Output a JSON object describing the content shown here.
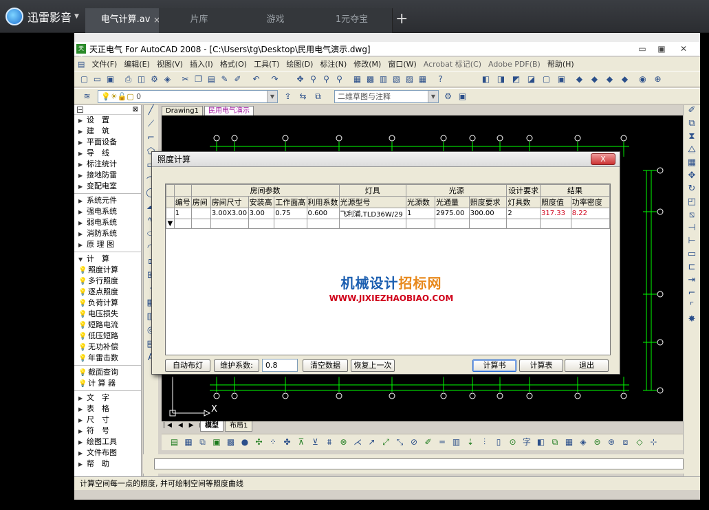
{
  "player": {
    "logo_text": "迅雷影音",
    "tabs": [
      {
        "label": "电气计算.av"
      },
      {
        "label": "片库"
      },
      {
        "label": "游戏"
      },
      {
        "label": "1元夺宝"
      }
    ],
    "tab_close": "×",
    "add_tab": "+"
  },
  "window": {
    "title": "天正电气 For AutoCAD 2008 - [C:\\Users\\tg\\Desktop\\民用电气演示.dwg]",
    "app_icon_text": "天正",
    "controls": [
      "▭",
      "▣",
      "✕"
    ]
  },
  "menu": [
    "文件(F)",
    "编辑(E)",
    "视图(V)",
    "插入(I)",
    "格式(O)",
    "工具(T)",
    "绘图(D)",
    "标注(N)",
    "修改(M)",
    "窗口(W)",
    "Acrobat 标记(C)",
    "Adobe PDF(B)",
    "帮助(H)"
  ],
  "toolbar": {
    "layer_value": "0",
    "workspace_value": "二维草图与注释"
  },
  "sidebar": {
    "items": [
      {
        "label": "设　置",
        "type": "group"
      },
      {
        "label": "建　筑",
        "type": "group"
      },
      {
        "label": "平面设备",
        "type": "group"
      },
      {
        "label": "导　线",
        "type": "group"
      },
      {
        "label": "标注统计",
        "type": "group"
      },
      {
        "label": "接地防雷",
        "type": "group"
      },
      {
        "label": "变配电室",
        "type": "group"
      },
      {
        "label": "系统元件",
        "type": "group"
      },
      {
        "label": "强电系统",
        "type": "group"
      },
      {
        "label": "弱电系统",
        "type": "group"
      },
      {
        "label": "消防系统",
        "type": "group"
      },
      {
        "label": "原 理 图",
        "type": "group"
      },
      {
        "label": "计　算",
        "type": "open"
      },
      {
        "label": "照度计算",
        "type": "cmd"
      },
      {
        "label": "多行照度",
        "type": "cmd"
      },
      {
        "label": "逐点照度",
        "type": "cmd"
      },
      {
        "label": "负荷计算",
        "type": "cmd"
      },
      {
        "label": "电压损失",
        "type": "cmd"
      },
      {
        "label": "短路电流",
        "type": "cmd"
      },
      {
        "label": "低压短路",
        "type": "cmd"
      },
      {
        "label": "无功补偿",
        "type": "cmd"
      },
      {
        "label": "年雷击数",
        "type": "cmd"
      },
      {
        "label": "截面查询",
        "type": "cmd"
      },
      {
        "label": "计 算 器",
        "type": "cmd"
      },
      {
        "label": "文　字",
        "type": "group"
      },
      {
        "label": "表　格",
        "type": "group"
      },
      {
        "label": "尺　寸",
        "type": "group"
      },
      {
        "label": "符　号",
        "type": "group"
      },
      {
        "label": "绘图工具",
        "type": "group"
      },
      {
        "label": "文件布图",
        "type": "group"
      },
      {
        "label": "帮　助",
        "type": "group"
      }
    ]
  },
  "doc_tabs": [
    "Drawing1",
    "民用电气演示"
  ],
  "layout_tabs": [
    "模型",
    "布局1"
  ],
  "status_text": "计算空间每一点的照度, 并可绘制空间等照度曲线",
  "dialog": {
    "title": "照度计算",
    "close_label": "X",
    "group_headers": [
      "房间参数",
      "灯具",
      "光源",
      "设计要求",
      "结果"
    ],
    "columns": [
      "编号",
      "房间",
      "房间尺寸",
      "安装高",
      "工作面高",
      "利用系数",
      "光源型号",
      "光源数",
      "光通量",
      "照度要求",
      "灯具数",
      "照度值",
      "功率密度"
    ],
    "rows": [
      [
        "1",
        "",
        "3.00X3.00",
        "3.00",
        "0.75",
        "0.600",
        "飞利浦,TLD36W/29",
        "1",
        "2975.00",
        "300.00",
        "2",
        "317.33",
        "8.22"
      ]
    ],
    "new_row_marker": "▼",
    "buttons": {
      "auto_layout": "自动布灯",
      "maint_label": "维护系数:",
      "maint_value": "0.8",
      "clear": "清空数据",
      "undo": "恢复上一次",
      "report": "计算书",
      "table": "计算表",
      "exit": "退出"
    }
  },
  "watermark": {
    "line1_a": "机械设计",
    "line1_b": "招标网",
    "line2": "WWW.JIXIEZHAOBIAO.COM"
  },
  "ucs_label": "X",
  "colors": {
    "accent_red": "#d0021b",
    "watermark_blue": "#1c5fb0",
    "watermark_orange": "#e8891c",
    "drawing_bg": "#000000",
    "grid_green": "#00ff00"
  }
}
